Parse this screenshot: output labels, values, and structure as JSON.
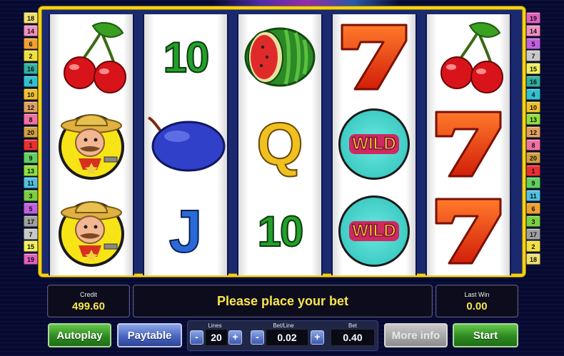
{
  "line_indicators": {
    "left": [
      "18",
      "14",
      "6",
      "2",
      "16",
      "4",
      "10",
      "12",
      "8",
      "20",
      "1",
      "9",
      "13",
      "11",
      "3",
      "5",
      "17",
      "7",
      "15",
      "19"
    ],
    "right": [
      "19",
      "14",
      "5",
      "7",
      "15",
      "16",
      "4",
      "10",
      "13",
      "12",
      "8",
      "20",
      "1",
      "9",
      "11",
      "6",
      "3",
      "17",
      "2",
      "18"
    ],
    "colors": {
      "1": "#e83030",
      "2": "#f0e040",
      "3": "#7ad040",
      "4": "#30c0d0",
      "5": "#c060e0",
      "6": "#f0a030",
      "7": "#c8c8c8",
      "8": "#f070a0",
      "9": "#60d060",
      "10": "#f0c030",
      "11": "#50c0e0",
      "12": "#e0a060",
      "13": "#90e040",
      "14": "#f090c0",
      "15": "#f0f060",
      "16": "#30b0a0",
      "17": "#a0a0a0",
      "18": "#f0e070",
      "19": "#e060c0",
      "20": "#d0a040"
    }
  },
  "reels": [
    [
      "cherry-icon",
      "sheriff-icon",
      "sheriff-icon"
    ],
    [
      "ten",
      "plum-icon",
      "jack"
    ],
    [
      "watermelon-icon",
      "queen",
      "ten"
    ],
    [
      "seven-icon",
      "wild",
      "wild"
    ],
    [
      "cherry-icon",
      "seven-icon",
      "seven-icon"
    ]
  ],
  "symbol_text": {
    "ten": "10",
    "jack": "J",
    "queen": "Q",
    "wild": "WILD"
  },
  "info": {
    "credit_label": "Credit",
    "credit_value": "499.60",
    "message": "Please place your bet",
    "last_win_label": "Last Win",
    "last_win_value": "0.00"
  },
  "controls": {
    "autoplay": "Autoplay",
    "paytable": "Paytable",
    "lines_label": "Lines",
    "lines_value": "20",
    "bet_line_label": "Bet/Line",
    "bet_line_value": "0.02",
    "bet_label": "Bet",
    "bet_value": "0.40",
    "minus": "-",
    "plus": "+",
    "more_info": "More info",
    "start": "Start"
  },
  "colors": {
    "frame": "#f2d21a",
    "value_text": "#f8e64a",
    "start_green": "#2f8a22",
    "paytable_blue": "#4a66c0"
  }
}
